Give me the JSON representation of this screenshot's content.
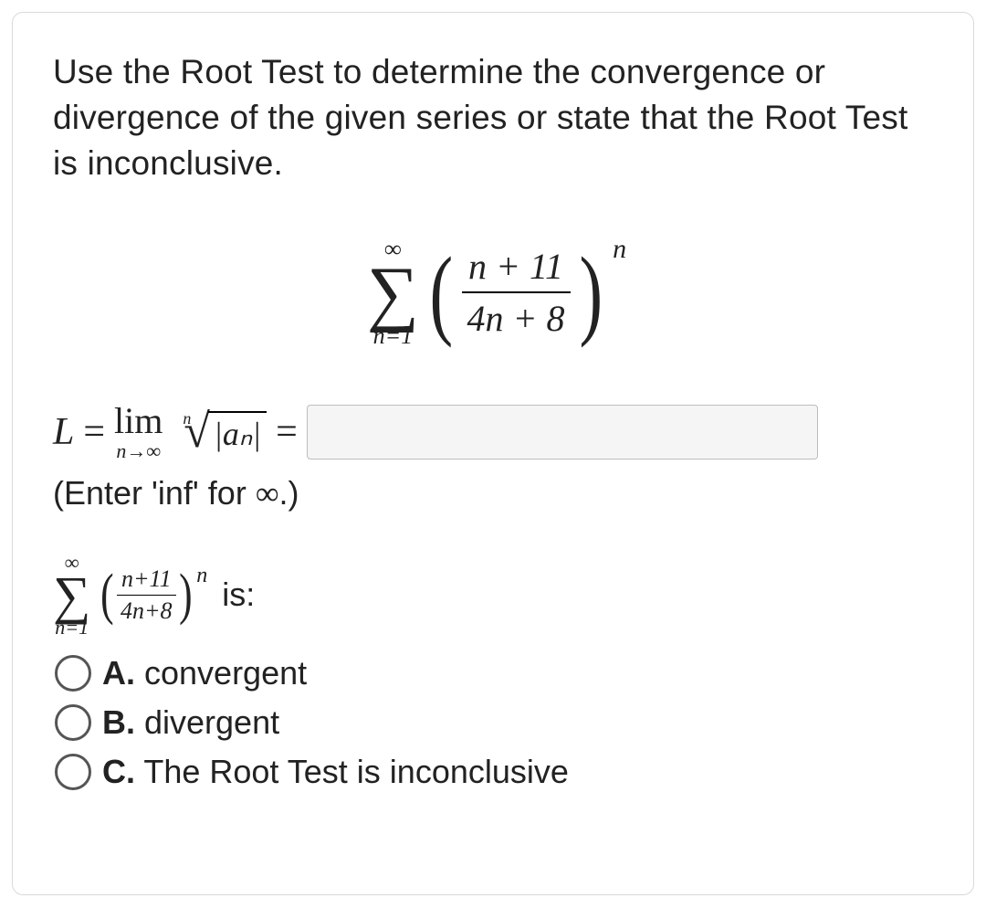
{
  "prompt": "Use the Root Test to determine the convergence or divergence of the given series or state that the Root Test is inconclusive.",
  "series": {
    "top": "∞",
    "bottom": "n=1",
    "numerator": "n + 11",
    "denominator": "4n + 8",
    "exponent": "n"
  },
  "limit": {
    "L": "L",
    "eq1": "=",
    "lim": "lim",
    "under": "n→∞",
    "root_index": "n",
    "radicand": "|aₙ|",
    "eq2": "="
  },
  "input": {
    "value": "",
    "placeholder": ""
  },
  "hint_prefix": "(Enter 'inf' for ",
  "hint_inf": "∞",
  "hint_suffix": ".)",
  "inline_series": {
    "top": "∞",
    "bottom": "n=1",
    "numerator": "n+11",
    "denominator": "4n+8",
    "exponent": "n",
    "is": "is:"
  },
  "options": {
    "a_letter": "A.",
    "a_text": " convergent",
    "b_letter": "B.",
    "b_text": " divergent",
    "c_letter": "C.",
    "c_text": " The Root Test is inconclusive"
  }
}
